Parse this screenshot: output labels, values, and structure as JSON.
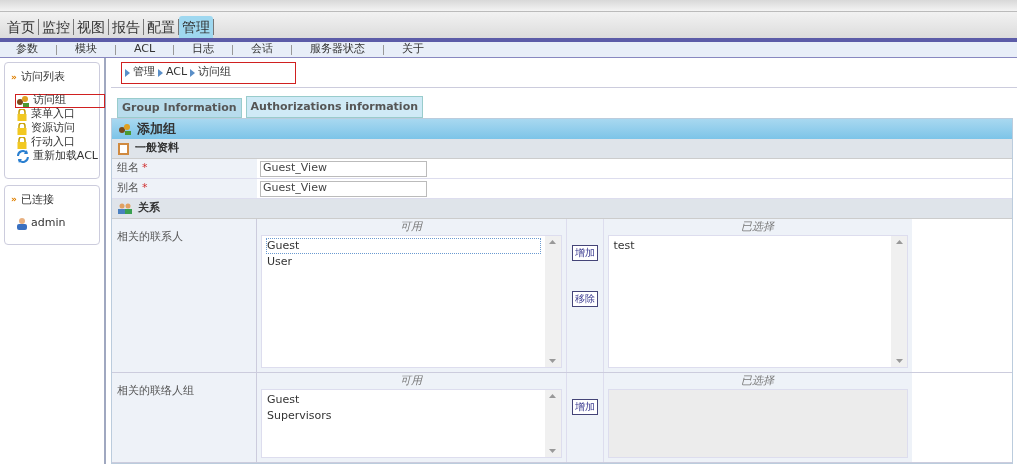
{
  "top_nav": [
    {
      "label": "首页",
      "selected": false
    },
    {
      "label": "监控",
      "selected": false
    },
    {
      "label": "视图",
      "selected": false
    },
    {
      "label": "报告",
      "selected": false
    },
    {
      "label": "配置",
      "selected": false
    },
    {
      "label": "管理",
      "selected": true
    }
  ],
  "sub_nav": [
    "参数",
    "模块",
    "ACL",
    "日志",
    "会话",
    "服务器状态",
    "关于"
  ],
  "sidebar": {
    "panels": [
      {
        "marker": "»",
        "title": "访问列表",
        "items": [
          {
            "label": "访问组",
            "kind": "group",
            "selected": true
          },
          {
            "label": "菜单入口",
            "kind": "lock",
            "selected": false
          },
          {
            "label": "资源访问",
            "kind": "lock",
            "selected": false
          },
          {
            "label": "行动入口",
            "kind": "lock",
            "selected": false
          },
          {
            "label": "重新加载ACL",
            "kind": "reload",
            "selected": false
          }
        ]
      },
      {
        "marker": "»",
        "title": "已连接",
        "items": [
          {
            "label": "admin",
            "kind": "user",
            "selected": false
          }
        ]
      }
    ]
  },
  "breadcrumb": [
    "管理",
    "ACL",
    "访问组"
  ],
  "tabs": [
    {
      "label": "Group Information",
      "selected": false
    },
    {
      "label": "Authorizations information",
      "selected": true
    }
  ],
  "form": {
    "title": "添加组",
    "general": {
      "title": "一般资料",
      "fields": [
        {
          "label": "组名",
          "required_mark": "*",
          "value": "Guest_View"
        },
        {
          "label": "别名",
          "required_mark": "*",
          "value": "Guest_View"
        }
      ]
    },
    "relations": {
      "title": "关系",
      "rows": [
        {
          "label": "相关的联系人",
          "available_title": "可用",
          "available": [
            {
              "label": "Guest",
              "selected": true
            },
            {
              "label": "User",
              "selected": false
            }
          ],
          "buttons": [
            "增加",
            "移除"
          ],
          "chosen_title": "已选择",
          "chosen": [
            "test"
          ],
          "chosen_disabled": false
        },
        {
          "label": "相关的联络人组",
          "available_title": "可用",
          "available": [
            {
              "label": "Guest",
              "selected": false
            },
            {
              "label": "Supervisors",
              "selected": false
            }
          ],
          "buttons": [
            "增加"
          ],
          "chosen_title": "已选择",
          "chosen": [],
          "chosen_disabled": true
        }
      ]
    }
  }
}
